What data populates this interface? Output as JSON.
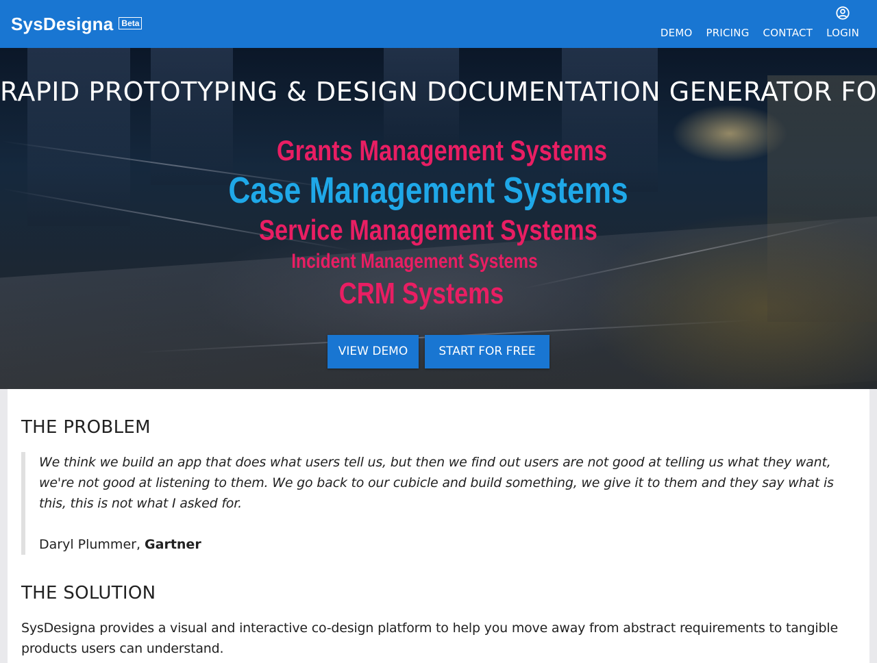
{
  "header": {
    "brand": "SysDesigna",
    "badge": "Beta",
    "nav": {
      "demo": "DEMO",
      "pricing": "PRICING",
      "contact": "CONTACT",
      "login": "LOGIN"
    },
    "login_icon": "account-circle-icon"
  },
  "hero": {
    "title": "RAPID PROTOTYPING & DESIGN DOCUMENTATION GENERATOR FOR",
    "systems": [
      "Grants Management Systems",
      "Case Management Systems",
      "Service Management Systems",
      "Incident Management Systems",
      "CRM Systems"
    ],
    "buttons": {
      "view_demo": "VIEW DEMO",
      "start_free": "START FOR FREE"
    }
  },
  "content": {
    "problem_heading": "THE PROBLEM",
    "quote": "We think we build an app that does what users tell us, but then we find out users are not good at telling us what they want, we're not good at listening to them. We go back to our cubicle and build something, we give it to them and they say what is this, this is not what I asked for.",
    "quote_author": "Daryl Plummer,",
    "quote_org": "Gartner",
    "solution_heading": "THE SOLUTION",
    "solution_text": "SysDesigna provides a visual and interactive co-design platform to help you move away from abstract requirements to tangible products users can understand."
  },
  "colors": {
    "primary": "#1976d2",
    "accent_pink": "#e91e63",
    "accent_blue": "#1fa8e8"
  }
}
